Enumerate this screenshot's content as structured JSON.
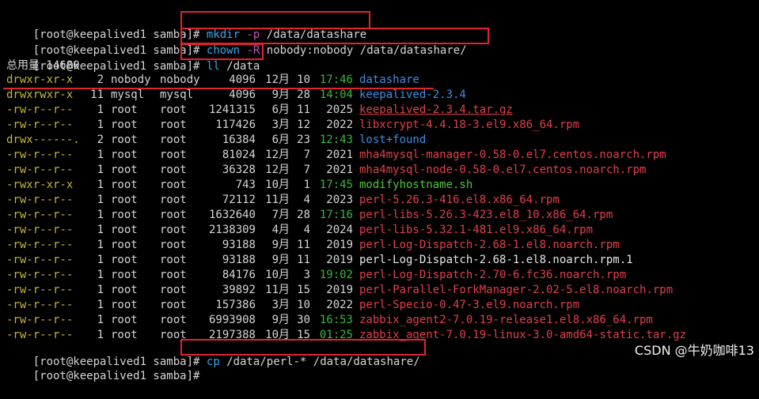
{
  "prompt": "[root@keepalived1 samba]",
  "prompt_hash": "#",
  "commands": [
    {
      "exe": "mkdir",
      "flag": "-p",
      "arg": "/data/datashare"
    },
    {
      "exe": "chown",
      "flag": "-R",
      "arg": "nobody:nobody /data/datashare/"
    },
    {
      "exe": "ll",
      "flag": "",
      "arg": "/data"
    },
    {
      "exe": "cp",
      "flag": "",
      "arg": "/data/perl-* /data/datashare/"
    }
  ],
  "total_line": "总用量 14680",
  "listing": [
    {
      "perm": "drwxr-xr-x",
      "links": "2",
      "owner": "nobody",
      "group": "nobody",
      "size": "4096",
      "month": "12月",
      "day": "10",
      "time": "17:46",
      "time_green": true,
      "name": "datashare",
      "name_color": "blue"
    },
    {
      "perm": "drwxrwxr-x",
      "links": "11",
      "owner": "mysql",
      "group": "mysql",
      "size": "4096",
      "month": "9月",
      "day": "28",
      "time": "14:04",
      "time_green": true,
      "name": "keepalived-2.3.4",
      "name_color": "blue"
    },
    {
      "perm": "-rw-r--r--",
      "links": "1",
      "owner": "root",
      "group": "root",
      "size": "1241315",
      "month": "6月",
      "day": "11",
      "time": "2025",
      "time_green": false,
      "name": "keepalived-2.3.4.tar.gz",
      "name_color": "red_underline"
    },
    {
      "perm": "-rw-r--r--",
      "links": "1",
      "owner": "root",
      "group": "root",
      "size": "117426",
      "month": "3月",
      "day": "12",
      "time": "2022",
      "time_green": false,
      "name": "libxcrypt-4.4.18-3.el9.x86_64.rpm",
      "name_color": "red"
    },
    {
      "perm": "drwx------.",
      "links": "2",
      "owner": "root",
      "group": "root",
      "size": "16384",
      "month": "6月",
      "day": "23",
      "time": "12:43",
      "time_green": true,
      "name": "lost+found",
      "name_color": "blue"
    },
    {
      "perm": "-rw-r--r--",
      "links": "1",
      "owner": "root",
      "group": "root",
      "size": "81024",
      "month": "12月",
      "day": "7",
      "time": "2021",
      "time_green": false,
      "name": "mha4mysql-manager-0.58-0.el7.centos.noarch.rpm",
      "name_color": "red"
    },
    {
      "perm": "-rw-r--r--",
      "links": "1",
      "owner": "root",
      "group": "root",
      "size": "36328",
      "month": "12月",
      "day": "7",
      "time": "2021",
      "time_green": false,
      "name": "mha4mysql-node-0.58-0.el7.centos.noarch.rpm",
      "name_color": "red"
    },
    {
      "perm": "-rwxr-xr-x",
      "links": "1",
      "owner": "root",
      "group": "root",
      "size": "743",
      "month": "10月",
      "day": "1",
      "time": "17:45",
      "time_green": true,
      "name": "modifyhostname.sh",
      "name_color": "green"
    },
    {
      "perm": "-rw-r--r--",
      "links": "1",
      "owner": "root",
      "group": "root",
      "size": "72112",
      "month": "11月",
      "day": "4",
      "time": "2023",
      "time_green": false,
      "name": "perl-5.26.3-416.el8.x86_64.rpm",
      "name_color": "red"
    },
    {
      "perm": "-rw-r--r--",
      "links": "1",
      "owner": "root",
      "group": "root",
      "size": "1632640",
      "month": "7月",
      "day": "28",
      "time": "17:16",
      "time_green": true,
      "name": "perl-libs-5.26.3-423.el8_10.x86_64.rpm",
      "name_color": "red"
    },
    {
      "perm": "-rw-r--r--",
      "links": "1",
      "owner": "root",
      "group": "root",
      "size": "2138309",
      "month": "4月",
      "day": "4",
      "time": "2024",
      "time_green": false,
      "name": "perl-libs-5.32.1-481.el9.x86_64.rpm",
      "name_color": "red"
    },
    {
      "perm": "-rw-r--r--",
      "links": "1",
      "owner": "root",
      "group": "root",
      "size": "93188",
      "month": "9月",
      "day": "11",
      "time": "2019",
      "time_green": false,
      "name": "perl-Log-Dispatch-2.68-1.el8.noarch.rpm",
      "name_color": "red"
    },
    {
      "perm": "-rw-r--r--",
      "links": "1",
      "owner": "root",
      "group": "root",
      "size": "93188",
      "month": "9月",
      "day": "11",
      "time": "2019",
      "time_green": false,
      "name": "perl-Log-Dispatch-2.68-1.el8.noarch.rpm.1",
      "name_color": "white"
    },
    {
      "perm": "-rw-r--r--",
      "links": "1",
      "owner": "root",
      "group": "root",
      "size": "84176",
      "month": "10月",
      "day": "3",
      "time": "19:02",
      "time_green": true,
      "name": "perl-Log-Dispatch-2.70-6.fc36.noarch.rpm",
      "name_color": "red"
    },
    {
      "perm": "-rw-r--r--",
      "links": "1",
      "owner": "root",
      "group": "root",
      "size": "39892",
      "month": "11月",
      "day": "15",
      "time": "2019",
      "time_green": false,
      "name": "perl-Parallel-ForkManager-2.02-5.el8.noarch.rpm",
      "name_color": "red"
    },
    {
      "perm": "-rw-r--r--",
      "links": "1",
      "owner": "root",
      "group": "root",
      "size": "157386",
      "month": "3月",
      "day": "10",
      "time": "2022",
      "time_green": false,
      "name": "perl-Specio-0.47-3.el9.noarch.rpm",
      "name_color": "red"
    },
    {
      "perm": "-rw-r--r--",
      "links": "1",
      "owner": "root",
      "group": "root",
      "size": "6993908",
      "month": "9月",
      "day": "30",
      "time": "16:53",
      "time_green": true,
      "name": "zabbix_agent2-7.0.19-release1.el8.x86_64.rpm",
      "name_color": "red"
    },
    {
      "perm": "-rw-r--r--",
      "links": "1",
      "owner": "root",
      "group": "root",
      "size": "2197388",
      "month": "10月",
      "day": "15",
      "time": "01:25",
      "time_green": true,
      "name": "zabbix_agent-7.0.19-linux-3.0-amd64-static.tar.gz",
      "name_color": "red"
    }
  ],
  "watermark": "CSDN @牛奶咖啡13",
  "colors": {
    "background": "#000000",
    "highlight_box": "#e0242f",
    "dir_name": "#3d8fe0",
    "archive_name": "#e0404a",
    "exec_name": "#53c43c",
    "perm": "#c4b73a",
    "command": "#39a6e9",
    "flag": "#c455b9"
  }
}
